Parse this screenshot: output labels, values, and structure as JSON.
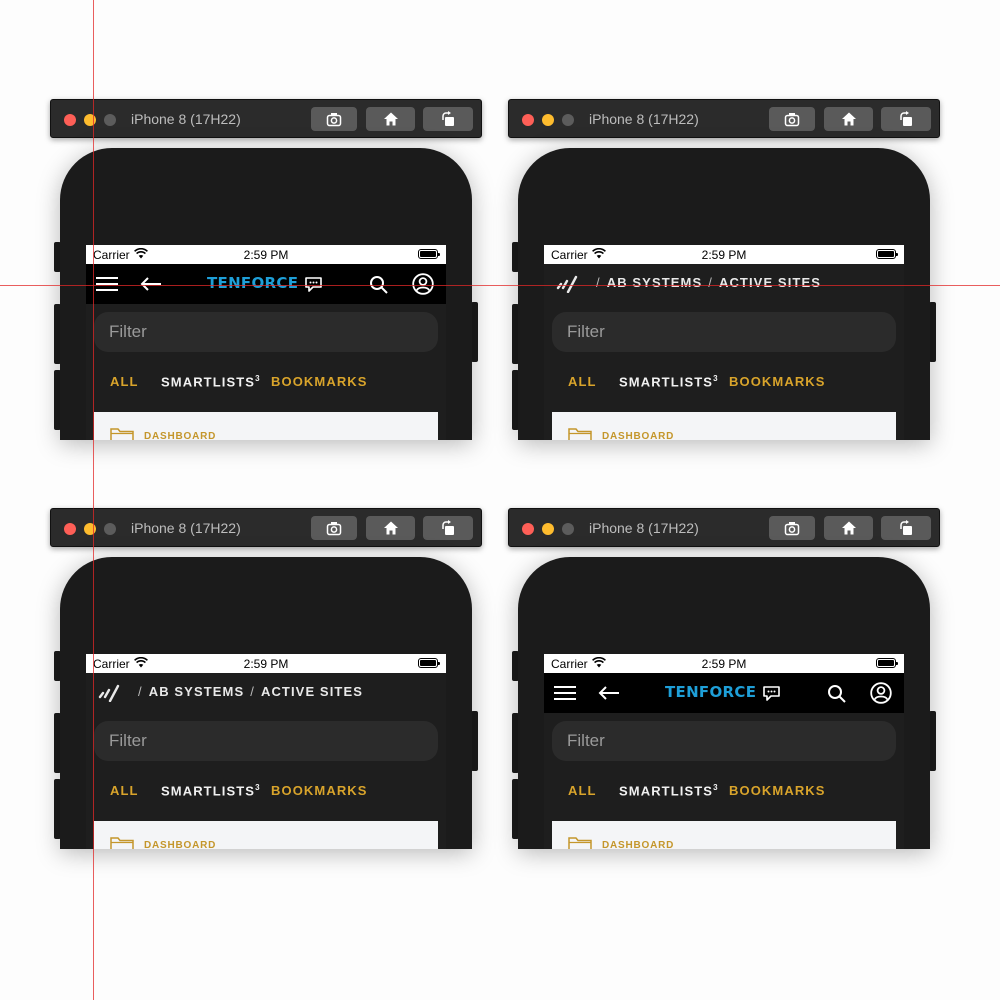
{
  "simulator": {
    "device_title": "iPhone 8 (17H22)",
    "toolbar_buttons": [
      "screenshot-icon",
      "home-icon",
      "rotate-icon"
    ]
  },
  "status_bar": {
    "carrier": "Carrier",
    "time": "2:59 PM"
  },
  "nav_tenforce": {
    "brand": "TENFORCE",
    "icons": [
      "menu-icon",
      "back-arrow-icon",
      "chat-icon",
      "search-icon",
      "profile-icon"
    ]
  },
  "nav_breadcrumb": {
    "items": [
      "AB SYSTEMS",
      "ACTIVE SITES"
    ],
    "separator": "/",
    "icon": "logo-slashes-icon"
  },
  "filter": {
    "placeholder": "Filter"
  },
  "tabs": {
    "all": "ALL",
    "smartlists": "SMARTLISTS",
    "smartlists_sup": "3",
    "bookmarks": "BOOKMARKS"
  },
  "list": {
    "first_item": "DASHBOARD"
  },
  "colors": {
    "accent_gold": "#d9a42b",
    "brand_blue": "#1e9fd8",
    "screen_bg": "#1e1e1e"
  }
}
